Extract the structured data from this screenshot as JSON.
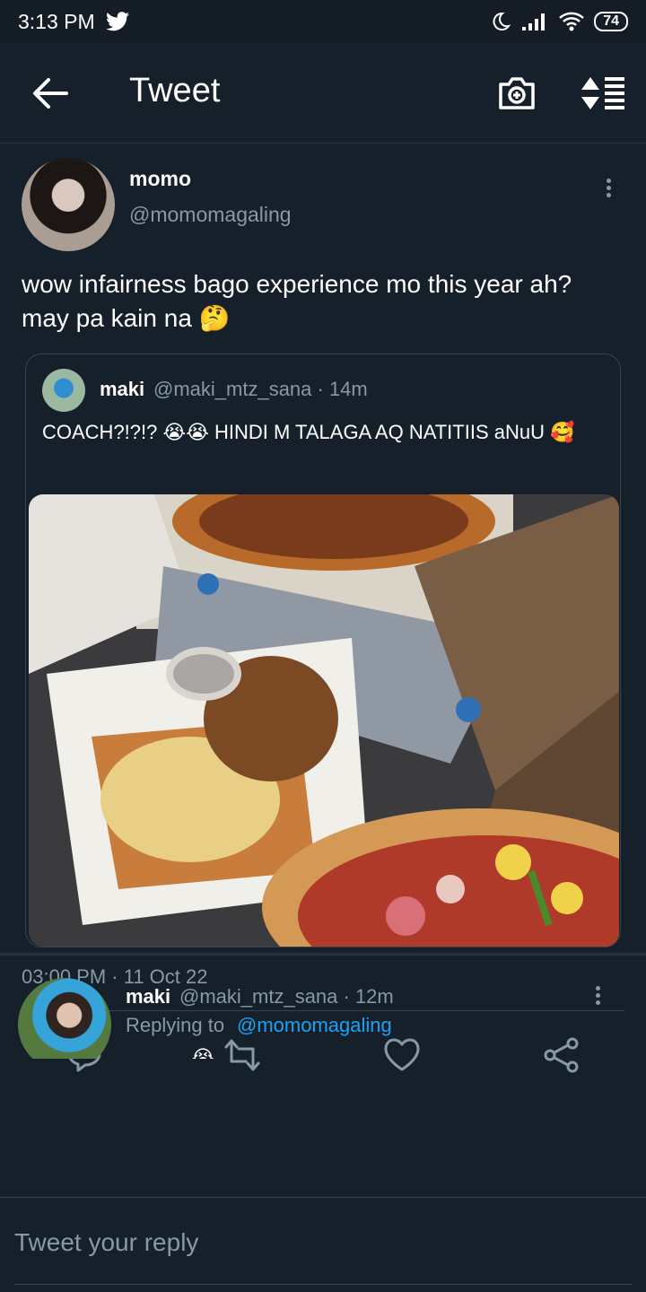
{
  "status_bar": {
    "time": "3:13 PM",
    "battery": "74"
  },
  "header": {
    "title": "Tweet"
  },
  "tweet": {
    "author_name": "momo",
    "author_handle": "@momomagaling",
    "text": "wow infairness bago experience mo this year ah? may pa kain na 🤔",
    "timestamp": "03:00 PM · 11 Oct 22"
  },
  "quote": {
    "author_name": "maki",
    "meta": "@maki_mtz_sana · 14m",
    "text": "COACH?!?!? 😭😭 HINDI M TALAGA AQ NATITIIS aNuU 🥰"
  },
  "reply": {
    "author_name": "maki",
    "meta": "@maki_mtz_sana · 12m",
    "replying_label": "Replying to",
    "replying_handle": "@momomagaling",
    "partial_text": "  ...  ...  ... 😭"
  },
  "compose": {
    "placeholder": "Tweet your reply"
  },
  "icons": {
    "back": "arrow-left-icon",
    "camera": "camera-icon",
    "sort": "sort-icon",
    "more": "more-vertical-icon",
    "reply": "reply-icon",
    "retweet": "retweet-icon",
    "like": "heart-icon",
    "share": "share-icon"
  },
  "colors": {
    "background": "#15202b",
    "link": "#1da1f2",
    "secondary_text": "#8899a6"
  }
}
